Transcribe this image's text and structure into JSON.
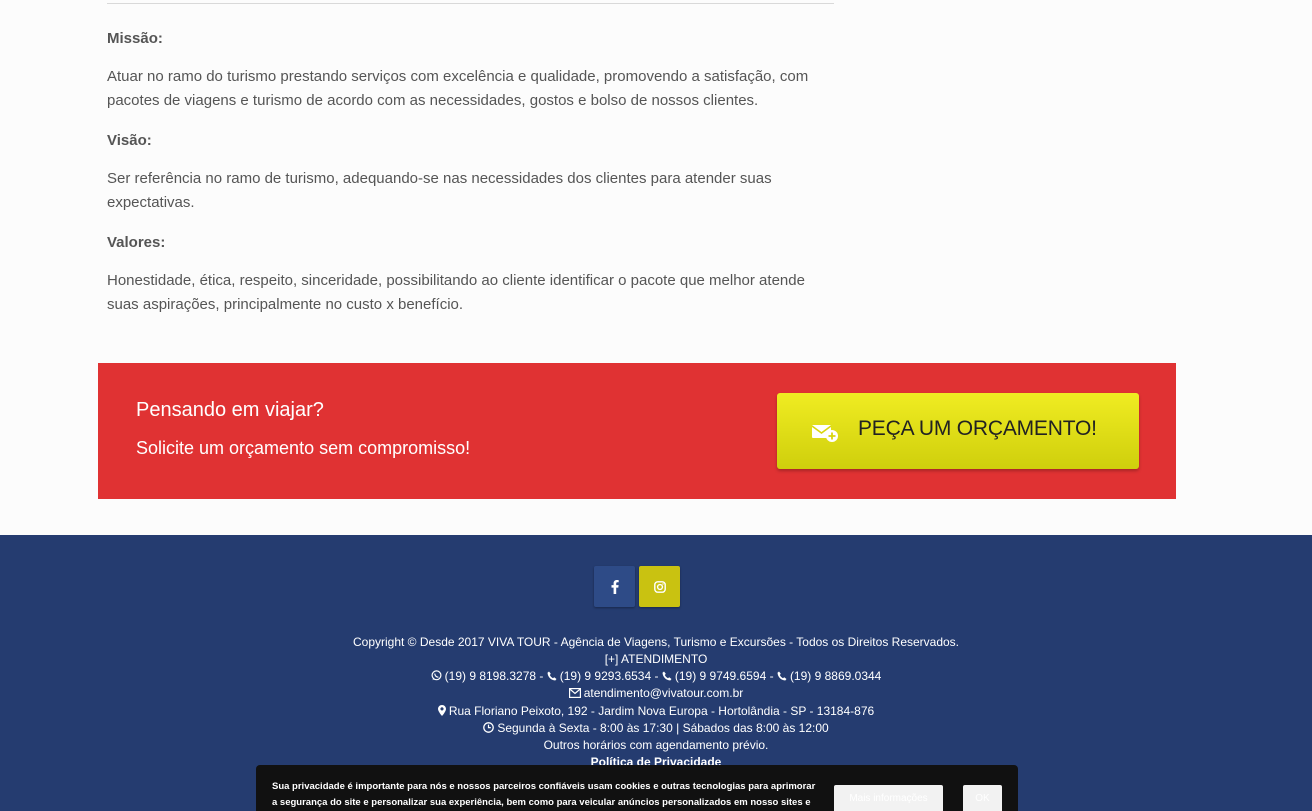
{
  "about": {
    "mission_title": "Missão:",
    "mission_text": "Atuar no ramo do turismo prestando serviços com excelência e qualidade, promovendo a satisfação, com pacotes de viagens e turismo de acordo com as necessidades, gostos e bolso de nossos clientes.",
    "vision_title": "Visão:",
    "vision_text": "Ser referência no ramo de turismo, adequando-se nas necessidades dos clientes para atender suas expectativas.",
    "values_title": "Valores:",
    "values_text": "Honestidade, ética, respeito, sinceridade, possibilitando ao cliente identificar o pacote que melhor atende suas aspirações, principalmente no custo x benefício."
  },
  "cta": {
    "title": "Pensando em viajar?",
    "subtitle": "Solicite um orçamento sem compromisso!",
    "button_label": "PEÇA UM ORÇAMENTO!",
    "button_icon": "envelope-plus-icon",
    "background_color": "#e03233",
    "button_color": "#e6e21a"
  },
  "footer": {
    "background_color": "#253c70",
    "social": [
      {
        "name": "facebook-icon",
        "color": "#2e4b87"
      },
      {
        "name": "instagram-icon",
        "color": "#c9c211"
      }
    ],
    "copyright": "Copyright © Desde 2017 VIVA TOUR - Agência de Viagens, Turismo e Excursões - Todos os Direitos Reservados.",
    "attendance": "[+] ATENDIMENTO",
    "phones": "(19) 9 8198.3278 - (19) 9 9293.6534 - (19) 9 9749.6594 - (19) 9 8869.0344",
    "phone_1": "(19) 9 8198.3278 -",
    "phone_2": "(19) 9 9293.6534 -",
    "phone_3": "(19) 9 9749.6594 -",
    "phone_4": "(19) 9 8869.0344",
    "email": "atendimento@vivatour.com.br",
    "address": "Rua Floriano Peixoto, 192 - Jardim Nova Europa - Hortolândia - SP - 13184-876",
    "hours": "Segunda à Sexta - 8:00 às 17:30 | Sábados das 8:00 às 12:00",
    "hours_note": "Outros horários com agendamento prévio.",
    "privacy": "Política de Privacidade"
  },
  "cookie_banner": {
    "text": "Sua privacidade é importante para nós e nossos parceiros confiáveis usam cookies e outras tecnologias para aprimorar a segurança do site e personalizar sua experiência, bem como para veicular anúncios personalizados em nosso sites e em",
    "more_button": "Mais informações",
    "ok_button": "OK"
  }
}
